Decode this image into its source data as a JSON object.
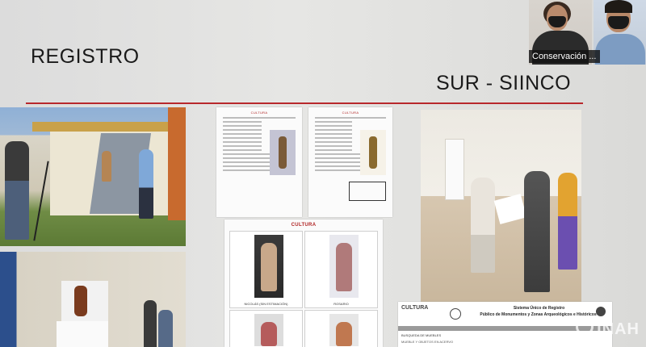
{
  "slide": {
    "title": "REGISTRO",
    "subtitle": "SUR - SIINCO",
    "accent_color": "#b8282c"
  },
  "documents": {
    "ficha_header": "CULTURA",
    "catalog_header": "CULTURA",
    "captions": [
      "NICOLÁS (SIN ESTIMACIÓN)",
      "ROSARIO"
    ],
    "siinco_logo": "CULTURA",
    "siinco_title_1": "Sistema Único de Registro",
    "siinco_title_2": "Público de Monumentos y Zonas Arqueológicos e Históricos",
    "search_label": "BUSQUEDA DE MUEBLES",
    "search_sub": "MUEBLE Y OBJETOS EN ACERVO"
  },
  "participants": [
    {
      "name": "Conservación ..."
    },
    {
      "name": ""
    }
  ],
  "watermark": "INAH",
  "icons": [
    "camera-off-icon",
    "inah-logo-icon"
  ]
}
